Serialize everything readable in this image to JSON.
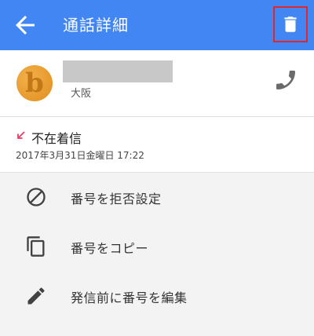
{
  "appbar": {
    "title": "通話詳細",
    "back_icon": "arrow-left-icon",
    "delete_icon": "trash-icon",
    "highlight_color": "#e0272b",
    "bg_color": "#4286f4"
  },
  "contact": {
    "avatar_letter": "b",
    "location": "大阪",
    "call_icon": "phone-icon"
  },
  "call": {
    "type": "不在着信",
    "datetime": "2017年3月31日金曜日 17:22",
    "missed_icon": "missed-call-arrow-icon",
    "missed_color": "#e53f66"
  },
  "actions": [
    {
      "label": "番号を拒否設定",
      "icon": "block-icon"
    },
    {
      "label": "番号をコピー",
      "icon": "copy-icon"
    },
    {
      "label": "発信前に番号を編集",
      "icon": "pencil-icon"
    }
  ]
}
